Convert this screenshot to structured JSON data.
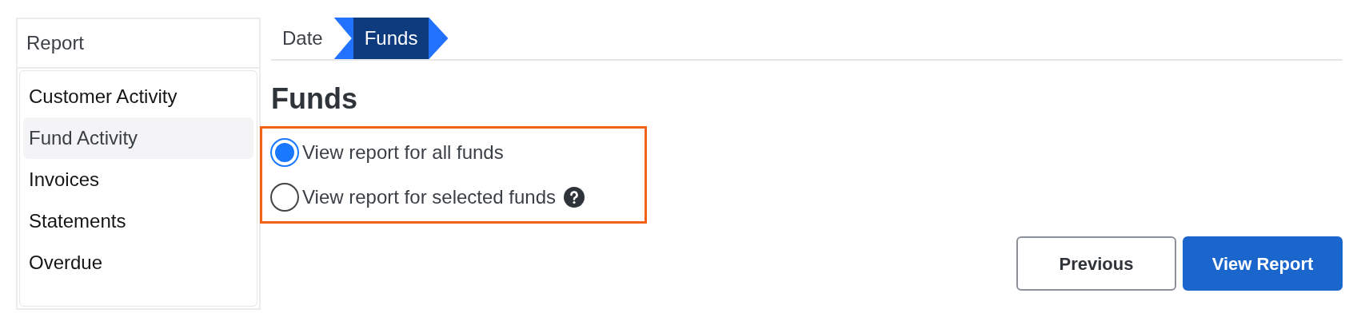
{
  "sidebar": {
    "title": "Report",
    "items": [
      {
        "label": "Customer Activity",
        "selected": false
      },
      {
        "label": "Fund Activity",
        "selected": true
      },
      {
        "label": "Invoices",
        "selected": false
      },
      {
        "label": "Statements",
        "selected": false
      },
      {
        "label": "Overdue",
        "selected": false
      }
    ]
  },
  "steps": [
    {
      "label": "Date",
      "selected": false
    },
    {
      "label": "Funds",
      "selected": true
    }
  ],
  "heading": "Funds",
  "options": [
    {
      "label": "View report for all funds",
      "selected": true,
      "help": false
    },
    {
      "label": "View report for selected funds",
      "selected": false,
      "help": true
    }
  ],
  "buttons": [
    {
      "label": "Previous",
      "kind": "secondary"
    },
    {
      "label": "View Report",
      "kind": "primary"
    }
  ]
}
